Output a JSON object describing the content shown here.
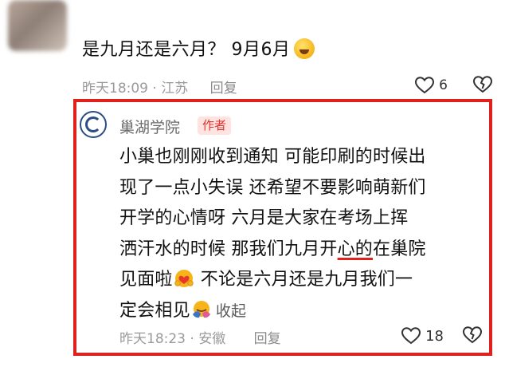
{
  "top_comment": {
    "text": "是九月还是六月？ 9月6月",
    "emoji": "laughing-sweat-emoji",
    "time": "昨天18:09",
    "location": "江苏",
    "reply_label": "回复",
    "like_count": "6"
  },
  "reply": {
    "author": "巢湖学院",
    "badge": "作者",
    "lines": [
      "小巢也刚刚收到通知 可能印刷的时候出",
      "现了一点小失误 还希望不要影响萌新们",
      "开学的心情呀 六月是大家在考场上挥",
      "洒汗水的时候 那我们九月开",
      "心的",
      "在巢院",
      "见面啦",
      " 不论是六月还是九月我们一",
      "定会相见",
      "收起"
    ],
    "time": "昨天18:23",
    "location": "安徽",
    "reply_label": "回复",
    "like_count": "18"
  },
  "colors": {
    "frame": "#e0211d",
    "badge_bg": "#ffe3e1",
    "badge_text": "#e0342e"
  }
}
